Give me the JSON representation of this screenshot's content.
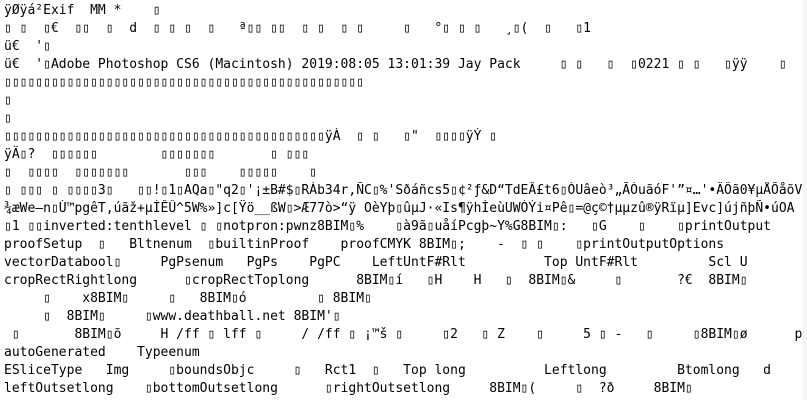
{
  "lines": [
    "ÿØÿá\u0011²Exif  MM *    ▯",
    "▯ ▯  ▯€  ▯▯  ▯  d  ▯ ▯ ▯  ▯   ª▯▯ ▯▯  ▯ ▯  ▯ ▯     ▯   °▯ ▯ ▯   ¸▯(  ▯   ▯1",
    "ü€  '▯",
    "ü€  '▯Adobe Photoshop CS6 (Macintosh) 2019:08:05 13:01:39 Jay Pack     ▯ ▯   ▯  ▯0221 ▯ ▯   ▯ÿÿ    ▯   ▯",
    "▯▯▯▯▯▯▯▯▯▯▯▯▯▯▯▯▯▯▯▯▯▯▯▯▯▯▯▯▯▯▯▯▯▯▯▯▯▯▯▯▯▯▯▯▯▯",
    "▯",
    "▯",
    "▯▯▯▯▯▯▯▯▯▯▯▯▯▯▯▯▯▯▯▯▯▯▯▯▯▯▯▯▯▯▯▯▯▯▯▯▯▯▯▯▯ÿÀ  ▯ ▯   ▯\"  ▯▯▯▯ÿÝ ▯",
    "ÿÄ▯?  ▯▯▯▯▯▯        ▯▯▯▯▯▯▯       ▯ ▯▯▯",
    "▯  ▯▯▯▯  ▯▯▯▯▯▯▯       ▯▯▯    ▯▯▯▯▯    ▯",
    "▯ ▯▯▯ ▯ ▯▯▯▯3▯   ▯▯!▯1▯AQa▯\"q2▯'¡±B#$▯RÁb34r,ÑC▯%'Sðáñcs5▯¢²ƒ&D“TdEÂ£t6▯ÒUâeò³„ÃÓuãóF'”¤…'•ÄÔã0¥µÅÕåõVfv†–¦",
    "¾æWe–n▯Ù™pgêT,úãž+µÍÊÛ^5W%»]c[Ÿö__ßW▯>Æ77ò>“ÿ OèYþ▯ûµJ·«Is¶ÿhÌeùUWÓÝi¤Pê▯=@ç©†µµzû®ÿRïµ]Evc]újñþÑ•úOA",
    "▯1 ▯▯inverted:tenthlevel ▯ ▯notpron:pwnz8BIM▯%    ▯à9ã▯uåíPcgþ~Y%G8BIM▯:   ▯G    ▯    ▯printOutput",
    "proofSetup  ▯   Bltnenum  ▯builtinProof    proofCMYK 8BIM▯;    -  ▯ ▯    ▯printOutputOptions",
    "vectorDatabool▯     PgPsenum   PgPs    PgPC    LeftUntF#Rlt          Top UntF#Rlt         Scl U",
    "cropRectRightlong      ▯cropRectToplong      8BIM▯í   ▯H    H   ▯  8BIM▯&     ▯       ?€  8BIM▯",
    "     ▯    x8BIM▯     ▯   8BIM▯ó         ▯ 8BIM▯",
    "     ▯  8BIM▯     ▯www.deathball.net 8BIM'▯",
    " ▯       8BIM▯õ     H /ff ▯ lff ▯     / /ff ▯ ¡™š ▯     ▯2   ▯ Z    ▯     5 ▯ -   ▯     ▯8BIM▯ø      p",
    "autoGenerated    Typeenum",
    "ESliceType   Img     ▯boundsObjc     ▯   Rct1  ▯   Top long          Leftlong         Btomlong   d",
    "leftOutsetlong    ▯bottomOutsetlong      ▯rightOutsetlong     8BIM▯(     ▯  ?ð     8BIM▯"
  ]
}
